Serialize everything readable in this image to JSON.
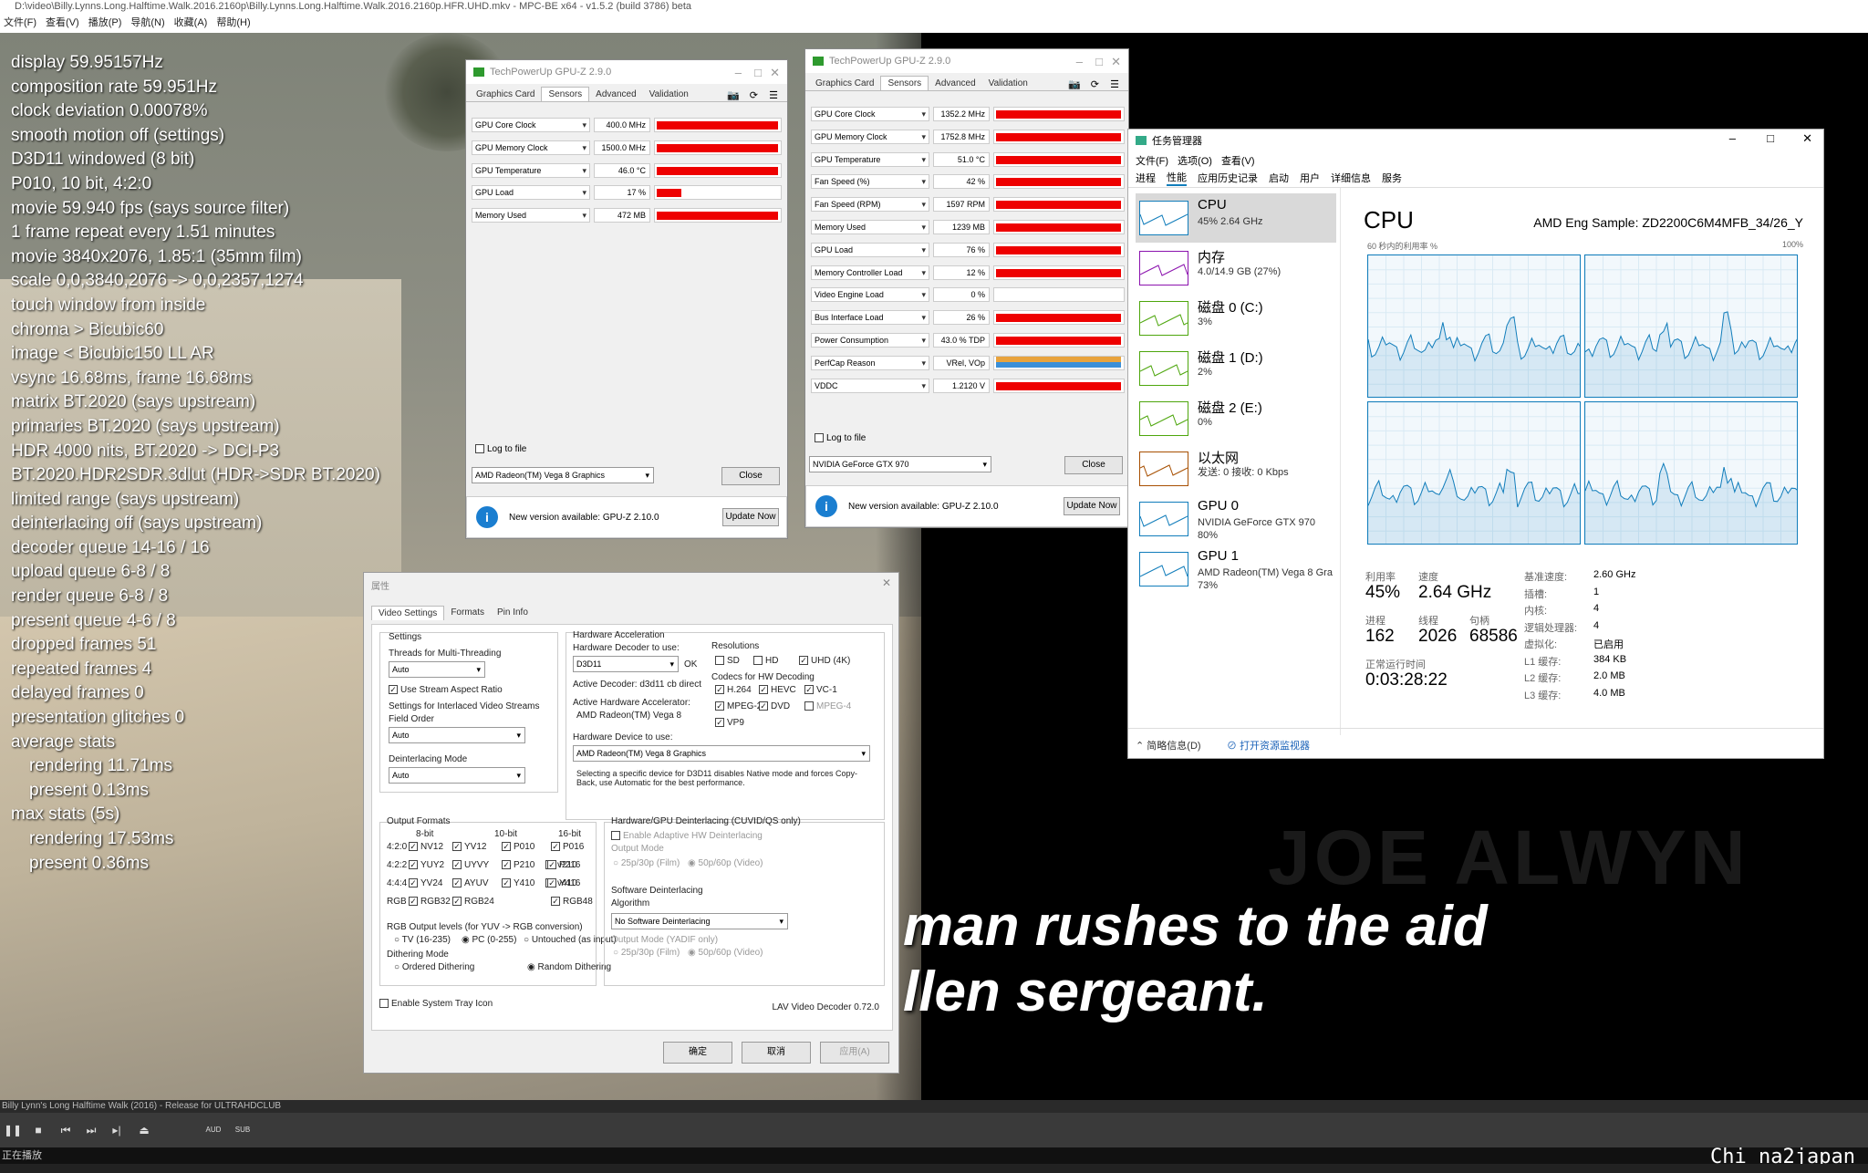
{
  "player": {
    "title": "D:\\video\\Billy.Lynns.Long.Halftime.Walk.2016.2160p\\Billy.Lynns.Long.Halftime.Walk.2016.2160p.HFR.UHD.mkv - MPC-BE x64 - v1.5.2 (build 3786) beta",
    "menu": [
      "文件(F)",
      "查看(V)",
      "播放(P)",
      "导航(N)",
      "收藏(A)",
      "帮助(H)"
    ],
    "seek_text": "Billy Lynn's Long Halftime Walk (2016) - Release for ULTRAHDCLUB",
    "controls": {
      "pause": "❚❚",
      "stop": "■",
      "prev": "⏮",
      "next": "⏭",
      "frame": "▸|",
      "eject": "⏏",
      "aud": "AUD",
      "sub": "SUB"
    },
    "status": "正在播放",
    "credit": "Chi na2japan",
    "subtitle_line1": "man rushes to the aid",
    "subtitle_line2": "llen sergeant.",
    "watermark": "JOE ALWYN"
  },
  "osd": [
    "display 59.95157Hz",
    "composition rate 59.951Hz",
    "clock deviation 0.00078%",
    "smooth motion off (settings)",
    "D3D11 windowed (8 bit)",
    "P010, 10 bit, 4:2:0",
    "movie 59.940 fps  (says source filter)",
    "1 frame repeat every 1.51 minutes",
    "movie 3840x2076, 1.85:1 (35mm film)",
    "scale 0,0,3840,2076 -> 0,0,2357,1274",
    "touch window from inside",
    "chroma > Bicubic60",
    "image < Bicubic150 LL AR",
    "vsync 16.68ms, frame 16.68ms",
    "matrix BT.2020 (says upstream)",
    "primaries BT.2020 (says upstream)",
    "HDR 4000 nits, BT.2020 -> DCI-P3",
    "BT.2020.HDR2SDR.3dlut (HDR->SDR BT.2020)",
    "limited range (says upstream)",
    "deinterlacing off (says upstream)",
    "decoder queue 14-16 / 16",
    "upload queue 6-8 / 8",
    "render queue 6-8 / 8",
    "present queue 4-6 / 8",
    "dropped frames 51",
    "repeated frames 4",
    "delayed frames 0",
    "presentation glitches 0",
    "average stats",
    "rendering 11.71ms",
    "present 0.13ms",
    "max stats (5s)",
    "rendering 17.53ms",
    "present 0.36ms"
  ],
  "gpuz1": {
    "title": "TechPowerUp GPU-Z 2.9.0",
    "tabs": [
      "Graphics Card",
      "Sensors",
      "Advanced",
      "Validation"
    ],
    "sensors": [
      {
        "name": "GPU Core Clock",
        "value": "400.0 MHz",
        "level": 0.98
      },
      {
        "name": "GPU Memory Clock",
        "value": "1500.0 MHz",
        "level": 0.98
      },
      {
        "name": "GPU Temperature",
        "value": "46.0 °C",
        "level": 0.98
      },
      {
        "name": "GPU Load",
        "value": "17 %",
        "level": 0.2
      },
      {
        "name": "Memory Used",
        "value": "472 MB",
        "level": 0.98
      }
    ],
    "log_label": "Log to file",
    "device": "AMD Radeon(TM) Vega 8 Graphics",
    "close": "Close",
    "update_msg": "New version available: GPU-Z 2.10.0",
    "update_btn": "Update Now"
  },
  "gpuz2": {
    "title": "TechPowerUp GPU-Z 2.9.0",
    "tabs": [
      "Graphics Card",
      "Sensors",
      "Advanced",
      "Validation"
    ],
    "sensors": [
      {
        "name": "GPU Core Clock",
        "value": "1352.2 MHz",
        "level": 0.98
      },
      {
        "name": "GPU Memory Clock",
        "value": "1752.8 MHz",
        "level": 0.98
      },
      {
        "name": "GPU Temperature",
        "value": "51.0 °C",
        "level": 0.98
      },
      {
        "name": "Fan Speed (%)",
        "value": "42 %",
        "level": 0.98
      },
      {
        "name": "Fan Speed (RPM)",
        "value": "1597 RPM",
        "level": 0.98
      },
      {
        "name": "Memory Used",
        "value": "1239 MB",
        "level": 0.98
      },
      {
        "name": "GPU Load",
        "value": "76 %",
        "level": 0.98
      },
      {
        "name": "Memory Controller Load",
        "value": "12 %",
        "level": 0.98
      },
      {
        "name": "Video Engine Load",
        "value": "0 %",
        "level": 0
      },
      {
        "name": "Bus Interface Load",
        "value": "26 %",
        "level": 0.98
      },
      {
        "name": "Power Consumption",
        "value": "43.0 % TDP",
        "level": 0.98
      },
      {
        "name": "PerfCap Reason",
        "value": "VRel, VOp",
        "level": 0.98
      },
      {
        "name": "VDDC",
        "value": "1.2120 V",
        "level": 0.98
      }
    ],
    "log_label": "Log to file",
    "device": "NVIDIA GeForce GTX 970",
    "close": "Close",
    "update_msg": "New version available: GPU-Z 2.10.0",
    "update_btn": "Update Now"
  },
  "taskmgr": {
    "title": "任务管理器",
    "menu": [
      "文件(F)",
      "选项(O)",
      "查看(V)"
    ],
    "tabs": [
      "进程",
      "性能",
      "应用历史记录",
      "启动",
      "用户",
      "详细信息",
      "服务"
    ],
    "side": [
      {
        "name": "CPU",
        "sub": "45% 2.64 GHz",
        "color": "#117dbb"
      },
      {
        "name": "内存",
        "sub": "4.0/14.9 GB (27%)",
        "color": "#8b12ae"
      },
      {
        "name": "磁盘 0 (C:)",
        "sub": "3%",
        "color": "#4da60c"
      },
      {
        "name": "磁盘 1 (D:)",
        "sub": "2%",
        "color": "#4da60c"
      },
      {
        "name": "磁盘 2 (E:)",
        "sub": "0%",
        "color": "#4da60c"
      },
      {
        "name": "以太网",
        "sub": "发送: 0 接收: 0 Kbps",
        "color": "#a74f01"
      },
      {
        "name": "GPU 0",
        "sub": "NVIDIA GeForce GTX 970",
        "sub2": "80%",
        "color": "#117dbb"
      },
      {
        "name": "GPU 1",
        "sub": "AMD Radeon(TM) Vega 8 Gra",
        "sub2": "73%",
        "color": "#117dbb"
      }
    ],
    "cpu_title": "CPU",
    "cpu_model": "AMD Eng Sample: ZD2200C6M4MFB_34/26_Y",
    "graph_label": "60 秒内的利用率 %",
    "graph_max": "100%",
    "stats": {
      "util_lbl": "利用率",
      "util": "45%",
      "speed_lbl": "速度",
      "speed": "2.64 GHz",
      "proc_lbl": "进程",
      "proc": "162",
      "thread_lbl": "线程",
      "thread": "2026",
      "handle_lbl": "句柄",
      "handle": "68586",
      "uptime_lbl": "正常运行时间",
      "uptime": "0:03:28:22"
    },
    "specs": [
      {
        "k": "基准速度:",
        "v": "2.60 GHz"
      },
      {
        "k": "插槽:",
        "v": "1"
      },
      {
        "k": "内核:",
        "v": "4"
      },
      {
        "k": "逻辑处理器:",
        "v": "4"
      },
      {
        "k": "虚拟化:",
        "v": "已启用"
      },
      {
        "k": "L1 缓存:",
        "v": "384 KB"
      },
      {
        "k": "L2 缓存:",
        "v": "2.0 MB"
      },
      {
        "k": "L3 缓存:",
        "v": "4.0 MB"
      }
    ],
    "footer_less": "简略信息(D)",
    "footer_monitor": "打开资源监视器"
  },
  "lav": {
    "title": "属性",
    "tabs": [
      "Video Settings",
      "Formats",
      "Pin Info"
    ],
    "settings_grp": "Settings",
    "threads_lbl": "Threads for Multi-Threading",
    "threads_val": "Auto",
    "stream_ar": "Use Stream Aspect Ratio",
    "interlaced_lbl": "Settings for Interlaced Video Streams",
    "field_lbl": "Field Order",
    "field_val": "Auto",
    "deint_lbl": "Deinterlacing Mode",
    "deint_val": "Auto",
    "hw_grp": "Hardware Acceleration",
    "hw_dec_lbl": "Hardware Decoder to use:",
    "hw_dec_val": "D3D11",
    "hw_ok": "OK",
    "active_dec": "Active Decoder:  d3d11 cb direct",
    "active_acc_lbl": "Active Hardware Accelerator:",
    "active_acc_val": "AMD Radeon(TM) Vega 8",
    "res_lbl": "Resolutions",
    "res": [
      "SD",
      "HD",
      "UHD (4K)"
    ],
    "codecs_lbl": "Codecs for HW Decoding",
    "codecs": [
      "H.264",
      "HEVC",
      "VC-1",
      "MPEG-2",
      "DVD",
      "MPEG-4",
      "VP9"
    ],
    "hw_dev_lbl": "Hardware Device to use:",
    "hw_dev_val": "AMD Radeon(TM) Vega 8 Graphics",
    "hw_note": "Selecting a specific device for D3D11 disables Native mode and forces Copy-Back, use Automatic for the best performance.",
    "out_grp": "Output Formats",
    "out_cols": [
      "8-bit",
      "10-bit",
      "16-bit"
    ],
    "out_rows": [
      {
        "label": "4:2:0",
        "items": [
          "NV12",
          "YV12",
          "P010",
          "P016"
        ]
      },
      {
        "label": "4:2:2",
        "items": [
          "YUY2",
          "UYVY",
          "P210",
          "v210",
          "P216"
        ]
      },
      {
        "label": "4:4:4",
        "items": [
          "YV24",
          "AYUV",
          "Y410",
          "v410",
          "Y416"
        ]
      },
      {
        "label": "RGB",
        "items": [
          "RGB32",
          "RGB24",
          "RGB48"
        ]
      }
    ],
    "rgb_levels_lbl": "RGB Output levels (for YUV -> RGB conversion)",
    "rgb_levels": [
      "TV (16-235)",
      "PC (0-255)",
      "Untouched (as input)"
    ],
    "dither_lbl": "Dithering Mode",
    "dither": [
      "Ordered Dithering",
      "Random Dithering"
    ],
    "gpu_deint_grp": "Hardware/GPU Deinterlacing (CUVID/QS only)",
    "adaptive": "Enable Adaptive HW Deinterlacing",
    "output_mode": "Output Mode",
    "mode_film": "25p/30p (Film)",
    "mode_video": "50p/60p (Video)",
    "sw_grp": "Software Deinterlacing",
    "algo_lbl": "Algorithm",
    "algo_val": "No Software Deinterlacing",
    "yadif_lbl": "Output Mode (YADIF only)",
    "tray": "Enable System Tray Icon",
    "version": "LAV Video Decoder 0.72.0",
    "ok": "确定",
    "cancel": "取消",
    "apply": "应用(A)"
  }
}
